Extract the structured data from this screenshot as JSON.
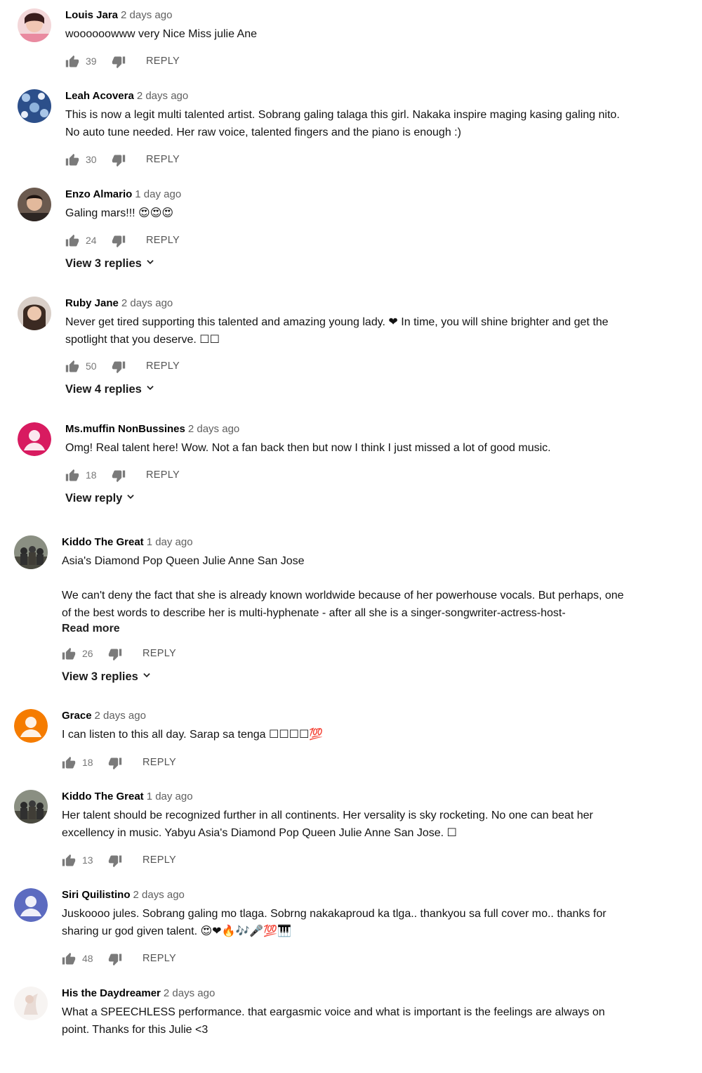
{
  "reply_label": "REPLY",
  "colors": {
    "thumb_gray": "#7a7a7a",
    "author": "#030303",
    "timestamp": "#606060",
    "text": "#131313"
  },
  "icons": {
    "like": "thumb-up-icon",
    "dislike": "thumb-down-icon",
    "expand": "chevron-down-icon"
  },
  "comments": [
    {
      "author": "Louis Jara",
      "time": "2 days ago",
      "lines": [
        "woooooowww very Nice Miss  julie Ane"
      ],
      "likes": "39",
      "replies": "",
      "avatar": "photo-pink"
    },
    {
      "author": "Leah Acovera",
      "time": "2 days ago",
      "lines": [
        "This is now a legit multi talented artist. Sobrang galing talaga this girl. Nakaka inspire maging kasing galing nito.",
        "No auto tune needed. Her raw voice, talented fingers and the piano is enough :)"
      ],
      "likes": "30",
      "replies": "",
      "avatar": "photo-blue-pattern"
    },
    {
      "author": "Enzo Almario",
      "time": "1 day ago",
      "lines": [
        "Galing mars!!! 😍😍😍"
      ],
      "likes": "24",
      "replies": "View 3 replies",
      "avatar": "photo-man"
    },
    {
      "author": "Ruby Jane",
      "time": "2 days ago",
      "lines": [
        "Never get tired supporting this talented and amazing young lady. ❤ In time, you will shine brighter and get the",
        "spotlight that you deserve. ☐☐"
      ],
      "likes": "50",
      "replies": "View 4 replies",
      "avatar": "photo-woman"
    },
    {
      "author": "Ms.muffin NonBussines",
      "time": "2 days ago",
      "lines": [
        "Omg! Real talent here! Wow. Not a fan back then but now I think I just missed a lot of good music."
      ],
      "likes": "18",
      "replies": "View reply",
      "avatar": "default-magenta"
    },
    {
      "author": "Kiddo The Great",
      "time": "1 day ago",
      "lines": [
        "Asia's Diamond Pop Queen Julie Anne San Jose",
        "",
        "We can't deny the fact that she is already known worldwide because of her powerhouse vocals. But perhaps, one",
        "of the best words to describe her is multi-hyphenate - after all she is  a singer-songwriter-actress-host-"
      ],
      "read_more": "Read more",
      "likes": "26",
      "replies": "View 3 replies",
      "avatar": "photo-group"
    },
    {
      "author": "Grace",
      "time": "2 days ago",
      "lines": [
        "I can listen to this all day. Sarap sa tenga ☐☐☐☐💯"
      ],
      "likes": "18",
      "replies": "",
      "avatar": "default-orange"
    },
    {
      "author": "Kiddo The Great",
      "time": "1 day ago",
      "lines": [
        "Her talent should be recognized further in all continents. Her versality is sky rocketing. No one can beat her",
        "excellency in music. Yabyu Asia's Diamond Pop Queen Julie Anne San Jose. ☐"
      ],
      "likes": "13",
      "replies": "",
      "avatar": "photo-group"
    },
    {
      "author": "Siri Quilistino",
      "time": "2 days ago",
      "lines": [
        "Juskoooo jules. Sobrang galing mo tlaga. Sobrng nakakaproud ka tlga.. thankyou sa full cover mo.. thanks for",
        "sharing ur god given talent. 😍❤🔥🎶🎤💯🎹"
      ],
      "likes": "48",
      "replies": "",
      "avatar": "default-blue"
    },
    {
      "author": "His the Daydreamer",
      "time": "2 days ago",
      "lines": [
        "What a SPEECHLESS performance. that eargasmic voice and what is important is the feelings are always on",
        "point.  Thanks for this Julie <3"
      ],
      "likes": "",
      "replies": "",
      "avatar": "photo-light"
    }
  ]
}
